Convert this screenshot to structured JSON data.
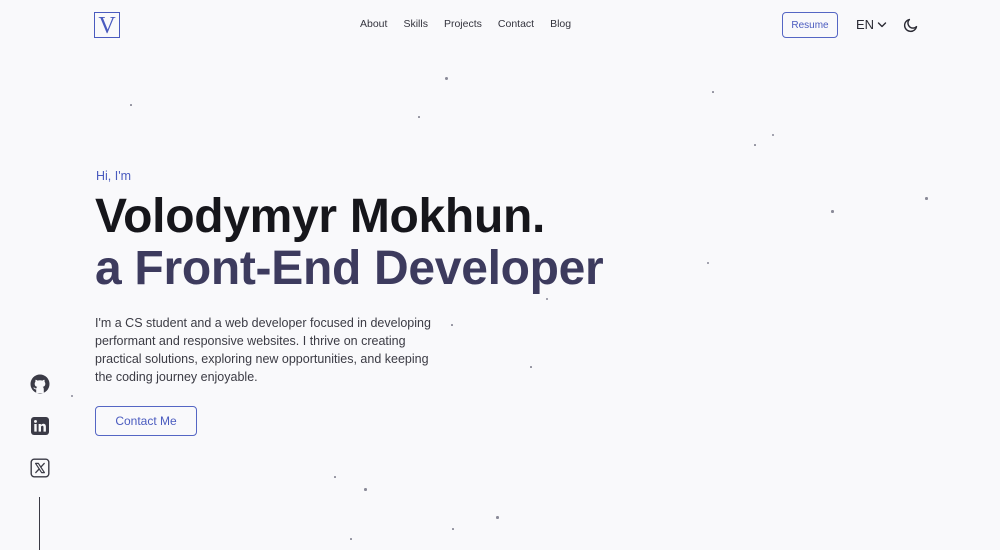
{
  "header": {
    "logo_letter": "V",
    "nav": [
      "About",
      "Skills",
      "Projects",
      "Contact",
      "Blog"
    ],
    "resume_label": "Resume",
    "language": "EN"
  },
  "hero": {
    "greeting": "Hi, I'm",
    "name": "Volodymyr Mokhun.",
    "role": "a Front-End Developer",
    "bio": "I'm a CS student and a web developer focused in developing performant and responsive websites. I thrive on creating practical solutions, exploring new opportunities, and keeping the coding journey enjoyable.",
    "cta_label": "Contact Me"
  },
  "social": {
    "icons": [
      "github-icon",
      "linkedin-icon",
      "x-twitter-icon"
    ]
  },
  "colors": {
    "accent": "#4a5bbf",
    "role_text": "#3d3b5e",
    "background": "#f9f9fb"
  }
}
